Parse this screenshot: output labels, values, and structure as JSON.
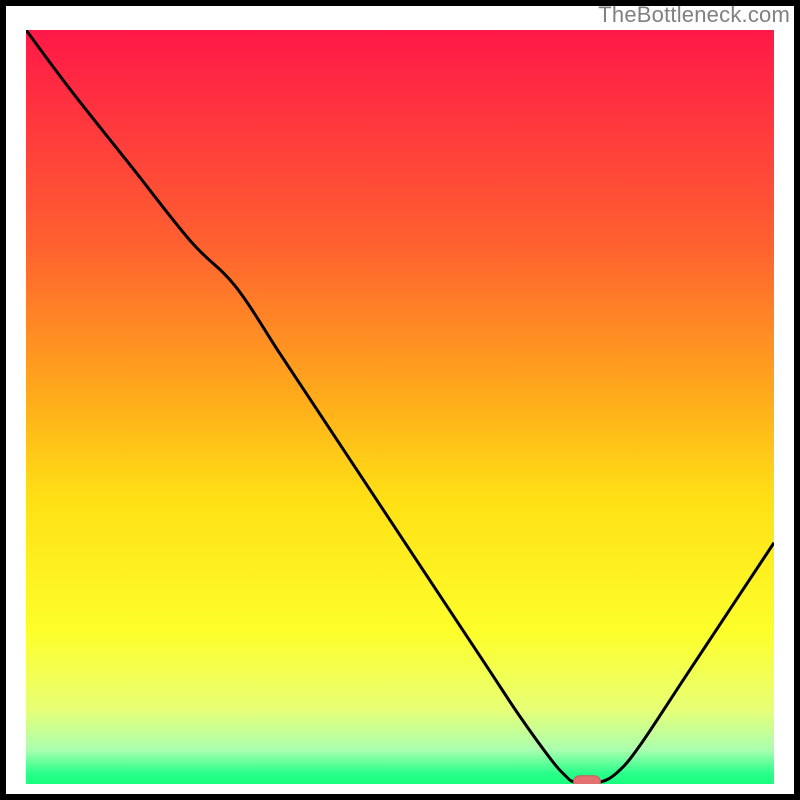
{
  "watermark": "TheBottleneck.com",
  "chart_data": {
    "type": "line",
    "title": "",
    "xlabel": "",
    "ylabel": "",
    "xlim": [
      0,
      100
    ],
    "ylim": [
      0,
      100
    ],
    "grid": false,
    "legend": false,
    "background_gradient_stops": [
      {
        "offset": 0.0,
        "color": "#ff1848"
      },
      {
        "offset": 0.28,
        "color": "#ff5f30"
      },
      {
        "offset": 0.5,
        "color": "#ffb01a"
      },
      {
        "offset": 0.62,
        "color": "#ffe015"
      },
      {
        "offset": 0.8,
        "color": "#fdff2b"
      },
      {
        "offset": 0.9,
        "color": "#e8ff75"
      },
      {
        "offset": 0.955,
        "color": "#aaffb0"
      },
      {
        "offset": 0.985,
        "color": "#2cff8a"
      },
      {
        "offset": 1.0,
        "color": "#18ff7f"
      }
    ],
    "series": [
      {
        "name": "bottleneck-curve",
        "color": "#000000",
        "width": 3,
        "x": [
          0.0,
          6.0,
          14.0,
          22.0,
          28.0,
          34.0,
          40.0,
          48.0,
          56.0,
          62.0,
          66.0,
          70.0,
          72.0,
          73.5,
          76.5,
          79.0,
          82.0,
          88.0,
          94.0,
          100.0
        ],
        "y": [
          100.0,
          92.0,
          82.0,
          72.0,
          66.0,
          57.0,
          48.0,
          36.0,
          24.0,
          15.0,
          9.0,
          3.5,
          1.2,
          0.2,
          0.2,
          1.5,
          5.0,
          14.0,
          23.0,
          32.0
        ]
      }
    ],
    "marker": {
      "name": "optimum-marker",
      "shape": "capsule",
      "x_center": 75.0,
      "y_center": 0.3,
      "width_x": 3.6,
      "height_y": 1.6,
      "fill": "#e27070",
      "stroke": "#c85a5a"
    },
    "border_color": "#000000",
    "border_width": 6
  }
}
